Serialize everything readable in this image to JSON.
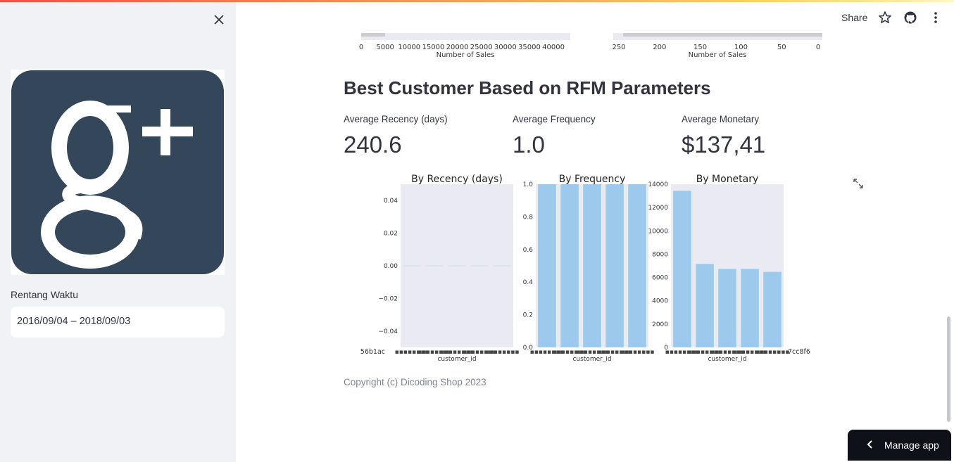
{
  "sidebar": {
    "date_label": "Rentang Waktu",
    "date_value": "2016/09/04 – 2018/09/03"
  },
  "header": {
    "share_label": "Share"
  },
  "top_axes": {
    "left": {
      "ticks": [
        "0",
        "5000",
        "10000",
        "15000",
        "20000",
        "25000",
        "30000",
        "35000",
        "40000"
      ],
      "xlabel": "Number of Sales"
    },
    "right": {
      "ticks": [
        "250",
        "200",
        "150",
        "100",
        "50",
        "0"
      ],
      "xlabel": "Number of Sales"
    }
  },
  "main": {
    "title": "Best Customer Based on RFM Parameters",
    "metrics": [
      {
        "label": "Average Recency (days)",
        "value": "240.6"
      },
      {
        "label": "Average Frequency",
        "value": "1.0"
      },
      {
        "label": "Average Monetary",
        "value": "$137,41"
      }
    ],
    "copyright": "Copyright (c) Dicoding Shop 2023"
  },
  "manage_app_label": "Manage app",
  "colors": {
    "bar": "#9dc9ec",
    "plot_bg": "#eaeaf2",
    "sidebar_bg": "#f0f2f6",
    "logo_bg": "#34465a"
  },
  "chart_data": [
    {
      "type": "bar",
      "title": "By Recency (days)",
      "xlabel": "customer_id",
      "ylabel": "",
      "ylim": [
        -0.05,
        0.05
      ],
      "yticks": [
        "0.04",
        "0.02",
        "0.00",
        "−0.02",
        "−0.04"
      ],
      "values": [
        0,
        0,
        0,
        0,
        0
      ],
      "x_tick_text": "56b1ac"
    },
    {
      "type": "bar",
      "title": "By Frequency",
      "xlabel": "customer_id",
      "ylabel": "",
      "ylim": [
        0,
        1.0
      ],
      "yticks": [
        "1.0",
        "0.8",
        "0.6",
        "0.4",
        "0.2",
        "0.0"
      ],
      "values": [
        1.0,
        1.0,
        1.0,
        1.0,
        1.0
      ]
    },
    {
      "type": "bar",
      "title": "By Monetary",
      "xlabel": "customer_id",
      "ylabel": "",
      "ylim": [
        0,
        14000
      ],
      "yticks": [
        "14000",
        "12000",
        "10000",
        "8000",
        "6000",
        "4000",
        "2000",
        "0"
      ],
      "values": [
        13440,
        7160,
        6730,
        6730,
        6480
      ],
      "x_tick_text": "7cc8f6"
    }
  ]
}
